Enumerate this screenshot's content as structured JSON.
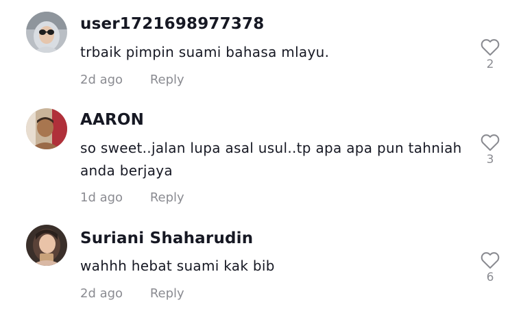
{
  "comments": [
    {
      "username": "user1721698977378",
      "text": "trbaik pimpin suami bahasa mlayu.",
      "time": "2d ago",
      "reply_label": "Reply",
      "likes": "2",
      "avatar_icon": "user-avatar-woman-sunglasses"
    },
    {
      "username": "AARON",
      "text": "so sweet..jalan lupa asal usul..tp apa apa pun tahniah anda berjaya",
      "time": "1d ago",
      "reply_label": "Reply",
      "likes": "3",
      "avatar_icon": "user-avatar-man"
    },
    {
      "username": "Suriani Shaharudin",
      "text": "wahhh hebat suami kak bib",
      "time": "2d ago",
      "reply_label": "Reply",
      "likes": "6",
      "avatar_icon": "user-avatar-woman"
    }
  ],
  "like_icon": "heart-outline-icon",
  "colors": {
    "text": "#161823",
    "secondary": "#8a8b91"
  }
}
